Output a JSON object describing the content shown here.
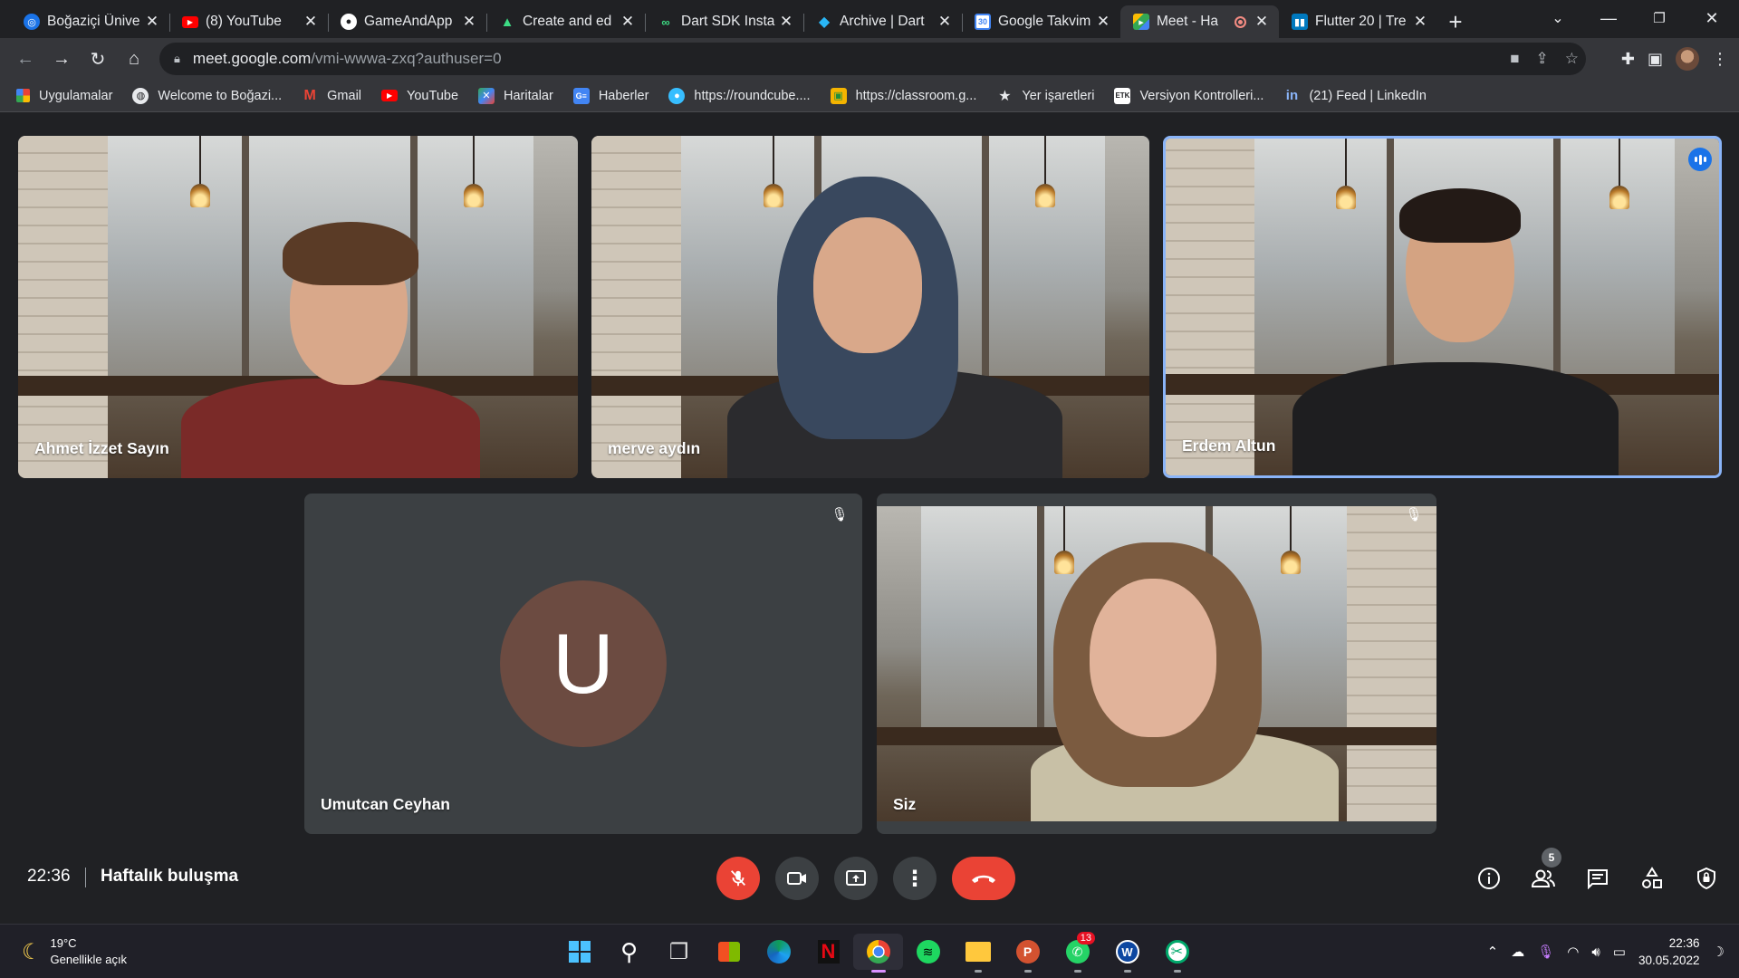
{
  "browser": {
    "tabs": [
      {
        "title": "Boğaziçi Ünive",
        "icon": "bogazici-icon",
        "color": "#1a73e8"
      },
      {
        "title": "(8) YouTube",
        "icon": "youtube-icon",
        "color": "#ff0000"
      },
      {
        "title": "GameAndApp",
        "icon": "github-icon",
        "color": "#ffffff"
      },
      {
        "title": "Create and ed",
        "icon": "android-icon",
        "color": "#3ddc84"
      },
      {
        "title": "Dart SDK Insta",
        "icon": "dart-icon",
        "color": "#0ea5e9"
      },
      {
        "title": "Archive | Dart",
        "icon": "dart-archive-icon",
        "color": "#1e88e5"
      },
      {
        "title": "Google Takvim",
        "icon": "google-calendar-icon",
        "color": "#4285f4"
      },
      {
        "title": "Meet - Ha",
        "icon": "google-meet-icon",
        "color": "#00ac47",
        "active": true,
        "recording": true
      },
      {
        "title": "Flutter 20 | Tre",
        "icon": "trello-icon",
        "color": "#0079bf"
      }
    ],
    "url_host": "meet.google.com",
    "url_path": "/vmi-wwwa-zxq?authuser=0",
    "bookmarks": [
      {
        "label": "Uygulamalar",
        "icon": "apps-grid-icon",
        "color": "#ea4335"
      },
      {
        "label": "Welcome to Boğazi...",
        "icon": "bogazici-icon",
        "color": "#e8eaed"
      },
      {
        "label": "Gmail",
        "icon": "gmail-icon",
        "color": "#ea4335"
      },
      {
        "label": "YouTube",
        "icon": "youtube-icon",
        "color": "#ff0000"
      },
      {
        "label": "Haritalar",
        "icon": "maps-icon",
        "color": "#34a853"
      },
      {
        "label": "Haberler",
        "icon": "news-icon",
        "color": "#4285f4"
      },
      {
        "label": "https://roundcube....",
        "icon": "roundcube-icon",
        "color": "#37beff"
      },
      {
        "label": "https://classroom.g...",
        "icon": "classroom-icon",
        "color": "#f4b400"
      },
      {
        "label": "Yer işaretleri",
        "icon": "star-icon",
        "color": "#e8eaed"
      },
      {
        "label": "Versiyon Kontrolleri...",
        "icon": "etk-icon",
        "color": "#ffffff"
      },
      {
        "label": "(21) Feed | LinkedIn",
        "icon": "linkedin-icon",
        "color": "#0a66c2"
      }
    ]
  },
  "meet": {
    "participants": [
      {
        "name": "Ahmet İzzet Sayın"
      },
      {
        "name": "merve aydın"
      },
      {
        "name": "Erdem Altun",
        "speaking": true
      },
      {
        "name": "Umutcan Ceyhan",
        "avatar_letter": "U",
        "muted": true
      },
      {
        "name": "Siz",
        "muted": true
      }
    ],
    "time": "22:36",
    "meeting_title": "Haftalık buluşma",
    "participant_count": "5",
    "colors": {
      "end_call": "#ea4335",
      "accent": "#8ab4f8",
      "avatar": "#6c4b41"
    }
  },
  "taskbar": {
    "temperature": "19°C",
    "weather": "Genellikle açık",
    "whatsapp_badge": "13",
    "clock_time": "22:36",
    "clock_date": "30.05.2022"
  }
}
